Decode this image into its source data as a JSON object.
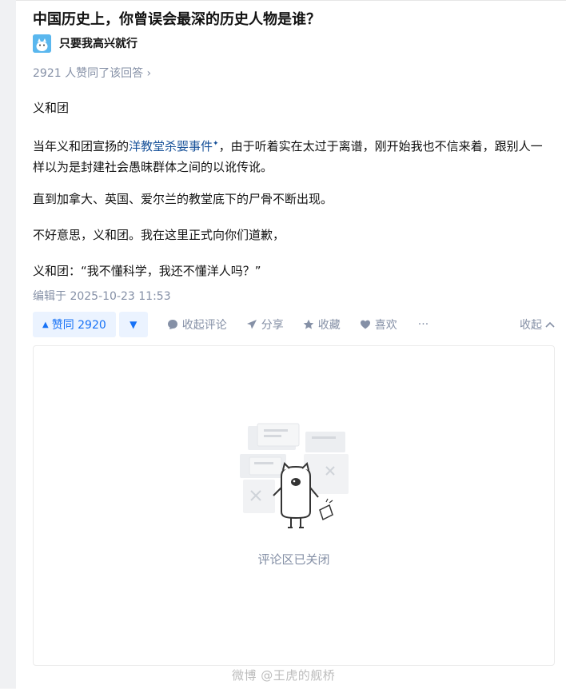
{
  "question": {
    "title": "中国历史上，你曾误会最深的历史人物是谁？"
  },
  "author": {
    "name": "只要我高兴就行"
  },
  "answer": {
    "votes_line": "2921 人赞同了该回答 ›",
    "p1": "义和团",
    "p2_before": "当年义和团宣扬的",
    "p2_link": "洋教堂杀婴事件",
    "p2_link_mark": "✦",
    "p2_after": "，由于听着实在太过于离谱，刚开始我也不信来着，跟别人一样以为是封建社会愚昧群体之间的以讹传讹。",
    "p3": "直到加拿大、英国、爱尔兰的教堂底下的尸骨不断出现。",
    "p4": "不好意思，义和团。我在这里正式向你们道歉，",
    "p5": "义和团：“我不懂科学，我还不懂洋人吗？”",
    "edited": "编辑于 2025-10-23 11:53"
  },
  "actions": {
    "upvote_icon": "▲",
    "upvote_label": "赞同 2920",
    "downvote_icon": "▼",
    "comment_label": "收起评论",
    "share_label": "分享",
    "collect_label": "收藏",
    "like_label": "喜欢",
    "more_label": "···",
    "collapse_label": "收起"
  },
  "comments": {
    "closed_text": "评论区已关闭"
  },
  "watermark": {
    "text": "微博 @王虎的舰桥"
  },
  "colors": {
    "accent": "#1772f6",
    "accent_bg": "#ebf3ff",
    "muted": "#8590a6",
    "link": "#175199"
  }
}
